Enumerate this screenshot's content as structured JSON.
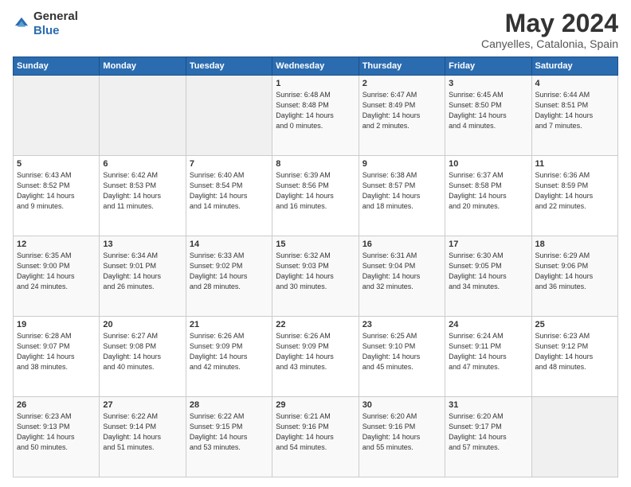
{
  "header": {
    "logo_general": "General",
    "logo_blue": "Blue",
    "title": "May 2024",
    "location": "Canyelles, Catalonia, Spain"
  },
  "columns": [
    "Sunday",
    "Monday",
    "Tuesday",
    "Wednesday",
    "Thursday",
    "Friday",
    "Saturday"
  ],
  "weeks": [
    [
      {
        "day": "",
        "sunrise": "",
        "sunset": "",
        "daylight": ""
      },
      {
        "day": "",
        "sunrise": "",
        "sunset": "",
        "daylight": ""
      },
      {
        "day": "",
        "sunrise": "",
        "sunset": "",
        "daylight": ""
      },
      {
        "day": "1",
        "sunrise": "Sunrise: 6:48 AM",
        "sunset": "Sunset: 8:48 PM",
        "daylight": "Daylight: 14 hours and 0 minutes."
      },
      {
        "day": "2",
        "sunrise": "Sunrise: 6:47 AM",
        "sunset": "Sunset: 8:49 PM",
        "daylight": "Daylight: 14 hours and 2 minutes."
      },
      {
        "day": "3",
        "sunrise": "Sunrise: 6:45 AM",
        "sunset": "Sunset: 8:50 PM",
        "daylight": "Daylight: 14 hours and 4 minutes."
      },
      {
        "day": "4",
        "sunrise": "Sunrise: 6:44 AM",
        "sunset": "Sunset: 8:51 PM",
        "daylight": "Daylight: 14 hours and 7 minutes."
      }
    ],
    [
      {
        "day": "5",
        "sunrise": "Sunrise: 6:43 AM",
        "sunset": "Sunset: 8:52 PM",
        "daylight": "Daylight: 14 hours and 9 minutes."
      },
      {
        "day": "6",
        "sunrise": "Sunrise: 6:42 AM",
        "sunset": "Sunset: 8:53 PM",
        "daylight": "Daylight: 14 hours and 11 minutes."
      },
      {
        "day": "7",
        "sunrise": "Sunrise: 6:40 AM",
        "sunset": "Sunset: 8:54 PM",
        "daylight": "Daylight: 14 hours and 14 minutes."
      },
      {
        "day": "8",
        "sunrise": "Sunrise: 6:39 AM",
        "sunset": "Sunset: 8:56 PM",
        "daylight": "Daylight: 14 hours and 16 minutes."
      },
      {
        "day": "9",
        "sunrise": "Sunrise: 6:38 AM",
        "sunset": "Sunset: 8:57 PM",
        "daylight": "Daylight: 14 hours and 18 minutes."
      },
      {
        "day": "10",
        "sunrise": "Sunrise: 6:37 AM",
        "sunset": "Sunset: 8:58 PM",
        "daylight": "Daylight: 14 hours and 20 minutes."
      },
      {
        "day": "11",
        "sunrise": "Sunrise: 6:36 AM",
        "sunset": "Sunset: 8:59 PM",
        "daylight": "Daylight: 14 hours and 22 minutes."
      }
    ],
    [
      {
        "day": "12",
        "sunrise": "Sunrise: 6:35 AM",
        "sunset": "Sunset: 9:00 PM",
        "daylight": "Daylight: 14 hours and 24 minutes."
      },
      {
        "day": "13",
        "sunrise": "Sunrise: 6:34 AM",
        "sunset": "Sunset: 9:01 PM",
        "daylight": "Daylight: 14 hours and 26 minutes."
      },
      {
        "day": "14",
        "sunrise": "Sunrise: 6:33 AM",
        "sunset": "Sunset: 9:02 PM",
        "daylight": "Daylight: 14 hours and 28 minutes."
      },
      {
        "day": "15",
        "sunrise": "Sunrise: 6:32 AM",
        "sunset": "Sunset: 9:03 PM",
        "daylight": "Daylight: 14 hours and 30 minutes."
      },
      {
        "day": "16",
        "sunrise": "Sunrise: 6:31 AM",
        "sunset": "Sunset: 9:04 PM",
        "daylight": "Daylight: 14 hours and 32 minutes."
      },
      {
        "day": "17",
        "sunrise": "Sunrise: 6:30 AM",
        "sunset": "Sunset: 9:05 PM",
        "daylight": "Daylight: 14 hours and 34 minutes."
      },
      {
        "day": "18",
        "sunrise": "Sunrise: 6:29 AM",
        "sunset": "Sunset: 9:06 PM",
        "daylight": "Daylight: 14 hours and 36 minutes."
      }
    ],
    [
      {
        "day": "19",
        "sunrise": "Sunrise: 6:28 AM",
        "sunset": "Sunset: 9:07 PM",
        "daylight": "Daylight: 14 hours and 38 minutes."
      },
      {
        "day": "20",
        "sunrise": "Sunrise: 6:27 AM",
        "sunset": "Sunset: 9:08 PM",
        "daylight": "Daylight: 14 hours and 40 minutes."
      },
      {
        "day": "21",
        "sunrise": "Sunrise: 6:26 AM",
        "sunset": "Sunset: 9:09 PM",
        "daylight": "Daylight: 14 hours and 42 minutes."
      },
      {
        "day": "22",
        "sunrise": "Sunrise: 6:26 AM",
        "sunset": "Sunset: 9:09 PM",
        "daylight": "Daylight: 14 hours and 43 minutes."
      },
      {
        "day": "23",
        "sunrise": "Sunrise: 6:25 AM",
        "sunset": "Sunset: 9:10 PM",
        "daylight": "Daylight: 14 hours and 45 minutes."
      },
      {
        "day": "24",
        "sunrise": "Sunrise: 6:24 AM",
        "sunset": "Sunset: 9:11 PM",
        "daylight": "Daylight: 14 hours and 47 minutes."
      },
      {
        "day": "25",
        "sunrise": "Sunrise: 6:23 AM",
        "sunset": "Sunset: 9:12 PM",
        "daylight": "Daylight: 14 hours and 48 minutes."
      }
    ],
    [
      {
        "day": "26",
        "sunrise": "Sunrise: 6:23 AM",
        "sunset": "Sunset: 9:13 PM",
        "daylight": "Daylight: 14 hours and 50 minutes."
      },
      {
        "day": "27",
        "sunrise": "Sunrise: 6:22 AM",
        "sunset": "Sunset: 9:14 PM",
        "daylight": "Daylight: 14 hours and 51 minutes."
      },
      {
        "day": "28",
        "sunrise": "Sunrise: 6:22 AM",
        "sunset": "Sunset: 9:15 PM",
        "daylight": "Daylight: 14 hours and 53 minutes."
      },
      {
        "day": "29",
        "sunrise": "Sunrise: 6:21 AM",
        "sunset": "Sunset: 9:16 PM",
        "daylight": "Daylight: 14 hours and 54 minutes."
      },
      {
        "day": "30",
        "sunrise": "Sunrise: 6:20 AM",
        "sunset": "Sunset: 9:16 PM",
        "daylight": "Daylight: 14 hours and 55 minutes."
      },
      {
        "day": "31",
        "sunrise": "Sunrise: 6:20 AM",
        "sunset": "Sunset: 9:17 PM",
        "daylight": "Daylight: 14 hours and 57 minutes."
      },
      {
        "day": "",
        "sunrise": "",
        "sunset": "",
        "daylight": ""
      }
    ]
  ]
}
